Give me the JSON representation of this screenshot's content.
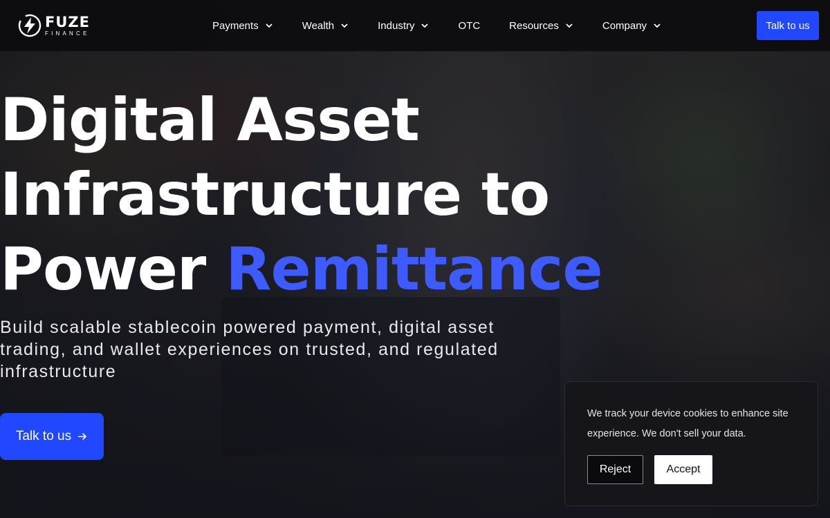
{
  "brand": {
    "logo_word": "FUZE",
    "logo_sub": "FINANCE",
    "accent_color": "#2148ff",
    "highlight_color": "#3d5bff"
  },
  "nav": {
    "items": [
      {
        "label": "Payments",
        "has_dropdown": true
      },
      {
        "label": "Wealth",
        "has_dropdown": true
      },
      {
        "label": "Industry",
        "has_dropdown": true
      },
      {
        "label": "OTC",
        "has_dropdown": false
      },
      {
        "label": "Resources",
        "has_dropdown": true
      },
      {
        "label": "Company",
        "has_dropdown": true
      }
    ],
    "cta_label": "Talk to us"
  },
  "hero": {
    "headline_line1": "Digital Asset",
    "headline_line2": "Infrastructure to",
    "headline_line3_plain": "Power",
    "headline_line3_accent": "Remittance",
    "subtitle": "Build scalable stablecoin powered payment, digital asset trading, and wallet experiences on trusted, and regulated infrastructure",
    "cta_label": "Talk to us",
    "cta_icon": "arrow-right-icon"
  },
  "cookie_banner": {
    "message": "We track your device cookies to enhance site experience. We don't sell your data.",
    "reject_label": "Reject",
    "accept_label": "Accept"
  }
}
